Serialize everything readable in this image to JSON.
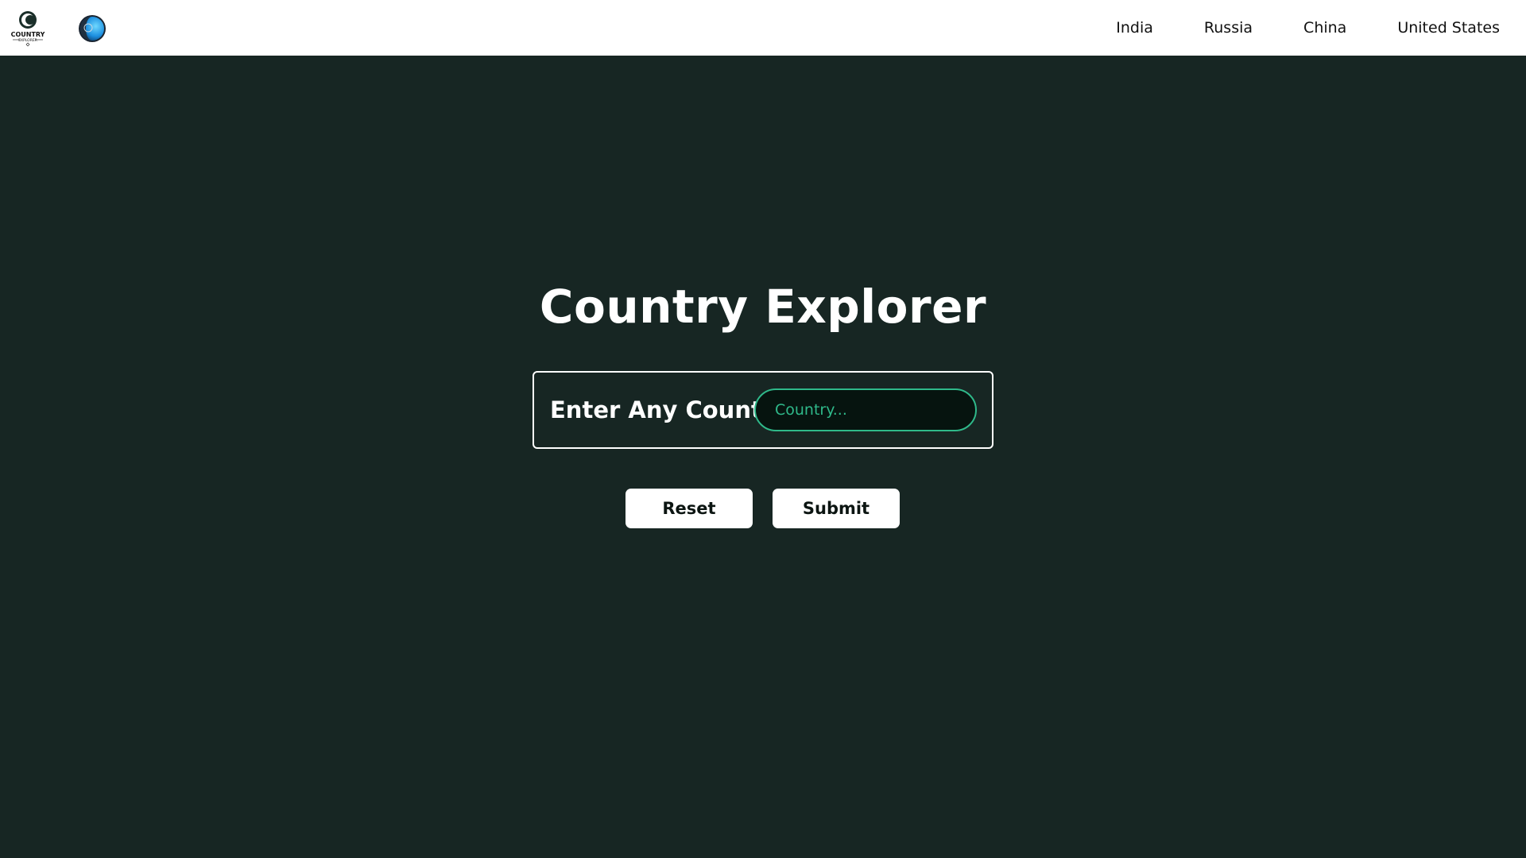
{
  "navbar": {
    "logo_text": "COUNTRY",
    "logo_subtext": "EXPLORER",
    "links": [
      "India",
      "Russia",
      "China",
      "United States"
    ]
  },
  "main": {
    "title": "Country Explorer",
    "form_label": "Enter Any Country",
    "input": {
      "placeholder": "Country...",
      "value": ""
    },
    "reset_label": "Reset",
    "submit_label": "Submit"
  },
  "colors": {
    "background": "#172623",
    "navbar": "#ffffff",
    "accent": "#2fb98a"
  }
}
